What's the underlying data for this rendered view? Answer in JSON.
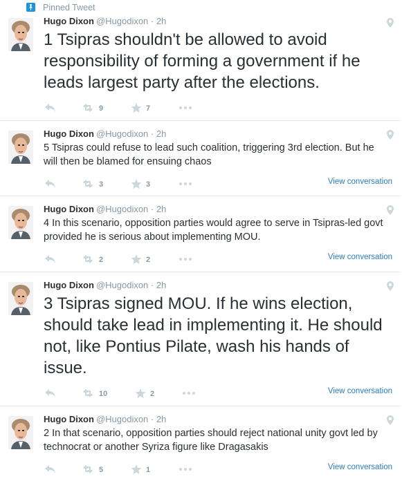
{
  "pinned_label": "Pinned Tweet",
  "tweets": [
    {
      "author": "Hugo Dixon",
      "handle": "@Hugodixon",
      "time": "2h",
      "text": "1 Tsipras shouldn't be allowed to avoid responsibility of forming a government if he leads largest party after the elections.",
      "retweets": "9",
      "favorites": "7",
      "view_conversation": ""
    },
    {
      "author": "Hugo Dixon",
      "handle": "@Hugodixon",
      "time": "2h",
      "text": "5 Tsipras could refuse to lead such coalition, triggering 3rd election. But he will then be blamed for ensuing chaos",
      "retweets": "3",
      "favorites": "3",
      "view_conversation": "View conversation"
    },
    {
      "author": "Hugo Dixon",
      "handle": "@Hugodixon",
      "time": "2h",
      "text": "4 In this scenario, opposition parties would agree to serve in Tsipras-led govt provided he is serious about implementing MOU.",
      "retweets": "2",
      "favorites": "2",
      "view_conversation": "View conversation"
    },
    {
      "author": "Hugo Dixon",
      "handle": "@Hugodixon",
      "time": "2h",
      "text": "3 Tsipras signed MOU. If he wins election, should take lead in implementing it. He should not, like Pontius Pilate, wash his hands of issue.",
      "retweets": "10",
      "favorites": "2",
      "view_conversation": "View conversation"
    },
    {
      "author": "Hugo Dixon",
      "handle": "@Hugodixon",
      "time": "2h",
      "text": "2 In that scenario, opposition parties should reject national unity govt led by technocrat or another Syriza figure like Dragasakis",
      "retweets": "5",
      "favorites": "1",
      "view_conversation": "View conversation"
    }
  ],
  "colors": {
    "link": "#2b7bb9",
    "muted": "#8899a6",
    "text": "#292f33",
    "pin": "#1b95e0",
    "divider": "#e1e8ed"
  },
  "icons": [
    "pin-icon",
    "avatar",
    "geo-pin-icon",
    "reply-icon",
    "retweet-icon",
    "favorite-icon",
    "more-icon"
  ]
}
